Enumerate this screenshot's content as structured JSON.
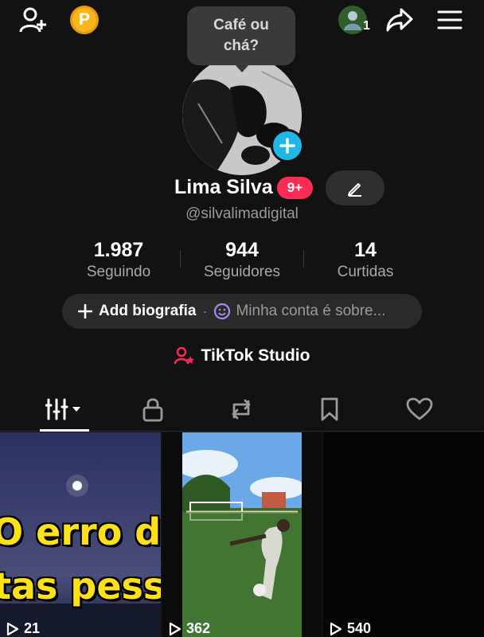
{
  "topbar": {
    "coin_letter": "P",
    "friends_count": "1"
  },
  "tooltip": {
    "line1": "Café ou",
    "line2": "chá?"
  },
  "profile": {
    "name": "Lima Silva",
    "badge": "9+",
    "handle": "@silvalimadigital"
  },
  "stats": [
    {
      "value": "1.987",
      "label": "Seguindo"
    },
    {
      "value": "944",
      "label": "Seguidores"
    },
    {
      "value": "14",
      "label": "Curtidas"
    }
  ],
  "bio": {
    "add_label": "Add biografia",
    "separator": "·",
    "about_placeholder": "Minha conta é sobre..."
  },
  "studio": {
    "label": "TikTok Studio"
  },
  "tabs": [
    "videos-tab",
    "private-tab",
    "reposts-tab",
    "saved-tab",
    "liked-tab"
  ],
  "videos": [
    {
      "views": "21",
      "caption_line1": "O erro de",
      "caption_line2": "tas pesso"
    },
    {
      "views": "362"
    },
    {
      "views": "540"
    }
  ],
  "colors": {
    "accent": "#fe2c55",
    "add_photo": "#20b6e8",
    "coin": "#f8b61b",
    "caption": "#ffe11a"
  }
}
